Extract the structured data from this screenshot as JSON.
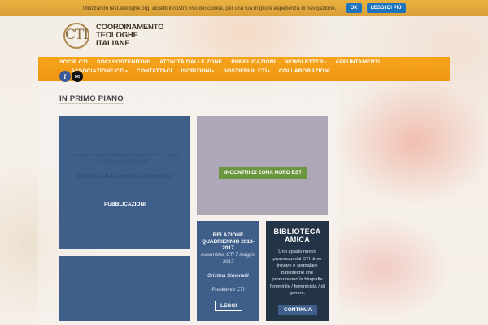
{
  "cookie": {
    "message": "Utilizzando test.teologhe.org, accetti il nostro uso dei cookie, per una tua migliore esperienza di navigazione.",
    "ok_label": "OK",
    "more_label": "LEGGI DI PIÙ"
  },
  "logo": {
    "mark": "CTI",
    "line1": "COORDINAMENTO",
    "line2": "TEOLOGHE",
    "line3": "ITALIANE"
  },
  "nav": {
    "row1": [
      {
        "label": "SOCIE CTI",
        "dropdown": false
      },
      {
        "label": "SOCI SOSTENITORI",
        "dropdown": false
      },
      {
        "label": "ATTIVITÀ DALLE ZONE",
        "dropdown": false
      },
      {
        "label": "PUBBLICAZIONI",
        "dropdown": false
      },
      {
        "label": "NEWSLETTER",
        "dropdown": true
      },
      {
        "label": "APPUNTAMENTI",
        "dropdown": false
      }
    ],
    "row2": [
      {
        "label": "ASSOCIAZIONE CTI",
        "dropdown": true
      },
      {
        "label": "CONTATTACI",
        "dropdown": false
      },
      {
        "label": "ISCRIZIONI",
        "dropdown": true
      },
      {
        "label": "SOSTIENI IL CTI",
        "dropdown": true
      },
      {
        "label": "COLLABORAZIONI",
        "dropdown": false
      }
    ]
  },
  "social": {
    "facebook": "f",
    "mail": "✉"
  },
  "section": {
    "title": "IN PRIMO PIANO"
  },
  "tiles": {
    "pubblicazioni": {
      "desc": "Il catalogo completo delle pubblicazioni CTI e le recenti pubblicazioni delle socie.",
      "quote": "Vocho voluto, scripto, ricevuto!",
      "label": "PUBBLICAZIONI"
    },
    "incontri": {
      "button": "INCONTRI DI ZONA NORD EST"
    },
    "relazione": {
      "title": "RELAZIONE QUADRIENNIO 2013-2017",
      "subtitle": "Assemblea CTI 7 maggio 2017",
      "name": "Cristina Simonelli",
      "role": "Presidente CTI",
      "button": "LEGGI"
    },
    "biblioteca": {
      "title": "BIBLIOTECA AMICA",
      "text": "Uno spazio nuovo promosso dal CTI dove trovare e segnalare Biblioteche che promuovono la biografia femminile / femminista / di genere.",
      "button": "CONTINUA"
    }
  },
  "colors": {
    "nav_orange": "#f6a41c",
    "cookie_bar": "#e0a93d",
    "tile_blue": "#3f5f8a",
    "tile_dark": "#243447",
    "tile_lilac": "#aea7b8",
    "button_green": "#6c9540"
  }
}
